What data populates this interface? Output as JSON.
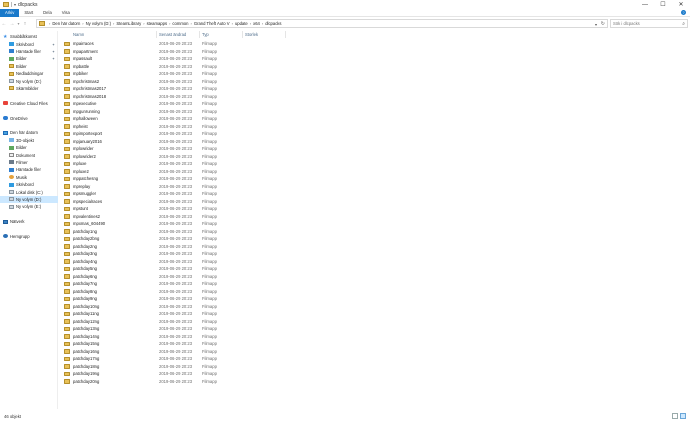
{
  "window": {
    "title": "dlcpacks",
    "controls": {
      "minimize": "—",
      "maximize": "☐",
      "close": "✕"
    }
  },
  "ribbon": {
    "tabs": [
      "Arkiv",
      "Start",
      "Dela",
      "Visa"
    ],
    "help": "?"
  },
  "address": {
    "crumbs": [
      "Den här datorn",
      "Ny volym (D:)",
      "SteamLibrary",
      "steamapps",
      "common",
      "Grand Theft Auto V",
      "update",
      "x64",
      "dlcpacks"
    ],
    "search_placeholder": "Sök i dlcpacks"
  },
  "nav": {
    "items": [
      {
        "label": "Snabbåtkomst",
        "icon": "star-icon",
        "indent": 0
      },
      {
        "label": "Skrivbord",
        "icon": "desktop-icon",
        "indent": 1,
        "pinned": true
      },
      {
        "label": "Hämtade filer",
        "icon": "downloads-icon",
        "indent": 1,
        "pinned": true
      },
      {
        "label": "Bilder",
        "icon": "pictures-icon",
        "indent": 1,
        "pinned": true
      },
      {
        "label": "Bilder",
        "icon": "folder-icon",
        "indent": 1
      },
      {
        "label": "Nedladdningar",
        "icon": "folder-icon",
        "indent": 1
      },
      {
        "label": "Ny volym (D:)",
        "icon": "drive-icon",
        "indent": 1
      },
      {
        "label": "Skärmbilder",
        "icon": "folder-icon",
        "indent": 1
      },
      {
        "label": "",
        "icon": "",
        "indent": 0
      },
      {
        "label": "Creative Cloud Files",
        "icon": "creative-cloud-icon",
        "indent": 0
      },
      {
        "label": "",
        "icon": "",
        "indent": 0
      },
      {
        "label": "OneDrive",
        "icon": "onedrive-icon",
        "indent": 0
      },
      {
        "label": "",
        "icon": "",
        "indent": 0
      },
      {
        "label": "Den här datorn",
        "icon": "computer-icon",
        "indent": 0
      },
      {
        "label": "3D-objekt",
        "icon": "3d-objects-icon",
        "indent": 1
      },
      {
        "label": "Bilder",
        "icon": "pictures-icon",
        "indent": 1
      },
      {
        "label": "Dokument",
        "icon": "documents-icon",
        "indent": 1
      },
      {
        "label": "Filmer",
        "icon": "videos-icon",
        "indent": 1
      },
      {
        "label": "Hämtade filer",
        "icon": "downloads-icon",
        "indent": 1
      },
      {
        "label": "Musik",
        "icon": "music-icon",
        "indent": 1
      },
      {
        "label": "Skrivbord",
        "icon": "desktop-icon",
        "indent": 1
      },
      {
        "label": "Lokal disk (C:)",
        "icon": "drive-icon",
        "indent": 1
      },
      {
        "label": "Ny volym (D:)",
        "icon": "drive-icon",
        "indent": 1,
        "selected": true
      },
      {
        "label": "Ny volym (E:)",
        "icon": "drive-icon",
        "indent": 1
      },
      {
        "label": "",
        "icon": "",
        "indent": 0
      },
      {
        "label": "Nätverk",
        "icon": "network-icon",
        "indent": 0
      },
      {
        "label": "",
        "icon": "",
        "indent": 0
      },
      {
        "label": "Hemgrupp",
        "icon": "homegroup-icon",
        "indent": 0
      }
    ]
  },
  "list": {
    "headers": {
      "name": "Namn",
      "date": "Senast ändrad",
      "type": "Typ",
      "size": "Storlek"
    },
    "rows": [
      {
        "name": "mpairraces",
        "date": "2019-06-29 20:23",
        "type": "Filmapp"
      },
      {
        "name": "mpapartment",
        "date": "2019-06-29 20:23",
        "type": "Filmapp"
      },
      {
        "name": "mpassault",
        "date": "2019-06-29 20:23",
        "type": "Filmapp"
      },
      {
        "name": "mpbattle",
        "date": "2019-06-29 20:23",
        "type": "Filmapp"
      },
      {
        "name": "mpbiker",
        "date": "2019-06-29 20:23",
        "type": "Filmapp"
      },
      {
        "name": "mpchristmas2",
        "date": "2019-06-29 20:23",
        "type": "Filmapp"
      },
      {
        "name": "mpchristmas2017",
        "date": "2019-06-29 20:23",
        "type": "Filmapp"
      },
      {
        "name": "mpchristmas2018",
        "date": "2019-06-29 20:23",
        "type": "Filmapp"
      },
      {
        "name": "mpexecutive",
        "date": "2019-06-29 20:23",
        "type": "Filmapp"
      },
      {
        "name": "mpgunrunning",
        "date": "2019-06-29 20:23",
        "type": "Filmapp"
      },
      {
        "name": "mphalloween",
        "date": "2019-06-29 20:23",
        "type": "Filmapp"
      },
      {
        "name": "mpheist",
        "date": "2019-06-29 20:23",
        "type": "Filmapp"
      },
      {
        "name": "mpimportexport",
        "date": "2019-06-29 20:23",
        "type": "Filmapp"
      },
      {
        "name": "mpjanuary2016",
        "date": "2019-06-29 20:23",
        "type": "Filmapp"
      },
      {
        "name": "mplowrider",
        "date": "2019-06-29 20:23",
        "type": "Filmapp"
      },
      {
        "name": "mplowrider2",
        "date": "2019-06-29 20:23",
        "type": "Filmapp"
      },
      {
        "name": "mpluxe",
        "date": "2019-06-29 20:23",
        "type": "Filmapp"
      },
      {
        "name": "mpluxe2",
        "date": "2019-06-29 20:23",
        "type": "Filmapp"
      },
      {
        "name": "mppatchesng",
        "date": "2019-06-29 20:23",
        "type": "Filmapp"
      },
      {
        "name": "mpreplay",
        "date": "2019-06-29 20:23",
        "type": "Filmapp"
      },
      {
        "name": "mpsmuggler",
        "date": "2019-06-29 20:23",
        "type": "Filmapp"
      },
      {
        "name": "mpspecialraces",
        "date": "2019-06-29 20:23",
        "type": "Filmapp"
      },
      {
        "name": "mpstunt",
        "date": "2019-06-29 20:23",
        "type": "Filmapp"
      },
      {
        "name": "mpvalentines2",
        "date": "2019-06-29 20:23",
        "type": "Filmapp"
      },
      {
        "name": "mpxmas_604490",
        "date": "2019-06-29 20:23",
        "type": "Filmapp"
      },
      {
        "name": "patchday1ng",
        "date": "2019-06-29 20:23",
        "type": "Filmapp"
      },
      {
        "name": "patchday2bng",
        "date": "2019-06-29 20:23",
        "type": "Filmapp"
      },
      {
        "name": "patchday2ng",
        "date": "2019-06-29 20:23",
        "type": "Filmapp"
      },
      {
        "name": "patchday3ng",
        "date": "2019-06-29 20:23",
        "type": "Filmapp"
      },
      {
        "name": "patchday4ng",
        "date": "2019-06-29 20:23",
        "type": "Filmapp"
      },
      {
        "name": "patchday5ng",
        "date": "2019-06-29 20:23",
        "type": "Filmapp"
      },
      {
        "name": "patchday6ng",
        "date": "2019-06-29 20:23",
        "type": "Filmapp"
      },
      {
        "name": "patchday7ng",
        "date": "2019-06-29 20:23",
        "type": "Filmapp"
      },
      {
        "name": "patchday8ng",
        "date": "2019-06-29 20:23",
        "type": "Filmapp"
      },
      {
        "name": "patchday9ng",
        "date": "2019-06-29 20:23",
        "type": "Filmapp"
      },
      {
        "name": "patchday10ng",
        "date": "2019-06-29 20:23",
        "type": "Filmapp"
      },
      {
        "name": "patchday11ng",
        "date": "2019-06-29 20:23",
        "type": "Filmapp"
      },
      {
        "name": "patchday12ng",
        "date": "2019-06-29 20:23",
        "type": "Filmapp"
      },
      {
        "name": "patchday13ng",
        "date": "2019-06-29 20:23",
        "type": "Filmapp"
      },
      {
        "name": "patchday14ng",
        "date": "2019-06-29 20:23",
        "type": "Filmapp"
      },
      {
        "name": "patchday15ng",
        "date": "2019-06-29 20:23",
        "type": "Filmapp"
      },
      {
        "name": "patchday16ng",
        "date": "2019-06-29 20:23",
        "type": "Filmapp"
      },
      {
        "name": "patchday17ng",
        "date": "2019-06-29 20:23",
        "type": "Filmapp"
      },
      {
        "name": "patchday18ng",
        "date": "2019-06-29 20:23",
        "type": "Filmapp"
      },
      {
        "name": "patchday19ng",
        "date": "2019-06-29 20:23",
        "type": "Filmapp"
      },
      {
        "name": "patchday20ng",
        "date": "2019-06-29 20:23",
        "type": "Filmapp"
      }
    ]
  },
  "status": {
    "count": "46 objekt"
  },
  "colors": {
    "accent": "#1979ca",
    "selected": "#cce8ff",
    "folder": "#e8c158",
    "header_text": "#4d6c8a"
  }
}
